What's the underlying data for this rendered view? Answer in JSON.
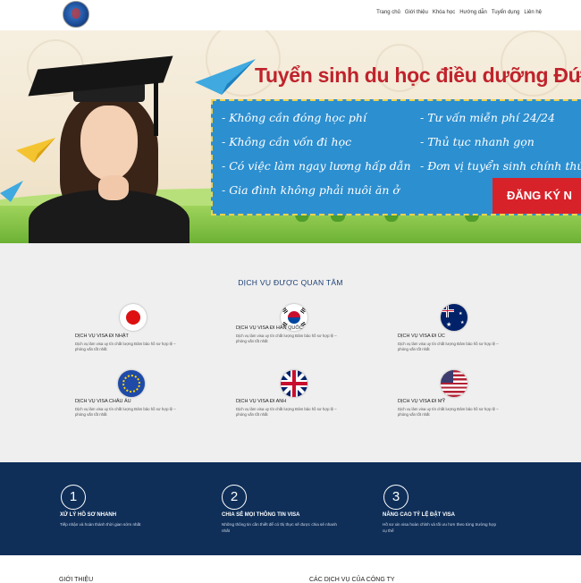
{
  "header": {
    "logo_alt": "logo",
    "nav": [
      "Trang chủ",
      "Giới thiệu",
      "Khóa học",
      "Hướng dẫn",
      "Tuyển dụng",
      "Liên hệ"
    ]
  },
  "hero": {
    "title": "Tuyển sinh du học điều dưỡng Đức",
    "left_items": [
      "- Không cần đóng học phí",
      "- Không cần vốn đi học",
      "- Có việc làm ngay lương hấp dẫn",
      "- Gia đình không phải nuôi ăn ở"
    ],
    "right_items": [
      "- Tư vấn miễn phí 24/24",
      "- Thủ tục nhanh gọn",
      "- Đơn vị tuyển sinh chính thức"
    ],
    "register_label": "ĐĂNG KÝ N"
  },
  "services": {
    "title": "DỊCH VỤ ĐƯỢC QUAN TÂM",
    "items": [
      {
        "flag": "japan-flag",
        "title": "DỊCH VỤ VISA ĐI NHẬT",
        "desc": "Dịch vụ làm visa uy tín chất lượng Đảm bảo hồ sơ hợp lệ – phỏng vấn tốt nhất"
      },
      {
        "flag": "korea-flag",
        "title": "DỊCH VỤ VISA ĐI HÀN QUỐC",
        "desc": "Dịch vụ làm visa uy tín chất lượng Đảm bảo hồ sơ hợp lệ – phỏng vấn tốt nhất"
      },
      {
        "flag": "australia-flag",
        "title": "DỊCH VỤ VISA ĐI ÚC",
        "desc": "Dịch vụ làm visa uy tín chất lượng Đảm bảo hồ sơ hợp lệ – phỏng vấn tốt nhất"
      },
      {
        "flag": "eu-flag",
        "title": "DỊCH VỤ VISA CHÂU ÂU",
        "desc": "Dịch vụ làm visa uy tín chất lượng Đảm bảo hồ sơ hợp lệ – phỏng vấn tốt nhất"
      },
      {
        "flag": "uk-flag",
        "title": "DỊCH VỤ VISA ĐI ANH",
        "desc": "Dịch vụ làm visa uy tín chất lượng Đảm bảo hồ sơ hợp lệ – phỏng vấn tốt nhất"
      },
      {
        "flag": "usa-flag",
        "title": "DỊCH VỤ VISA ĐI MỸ",
        "desc": "Dịch vụ làm visa uy tín chất lượng Đảm bảo hồ sơ hợp lệ – phỏng vấn tốt nhất"
      }
    ]
  },
  "steps": [
    {
      "number": "1",
      "title": "XỬ LÝ HỒ SƠ NHANH",
      "desc": "Tiếp nhận và hoàn thành thời gian sớm nhất"
    },
    {
      "number": "2",
      "title": "CHIA SẺ MỌI THÔNG TIN VISA",
      "desc": "Những thông tin cần thiết để có thị thực sẽ được chia sẻ nhanh nhất"
    },
    {
      "number": "3",
      "title": "NÂNG CAO TỶ LỆ ĐẬT VISA",
      "desc": "Hồ sơ xin visa hoàn chỉnh và tối ưu hơn theo từng trường hợp cụ thể"
    }
  ],
  "footer": {
    "left_title": "GIỚI THIỆU",
    "right_title": "CÁC DỊCH VỤ CỦA CÔNG TY"
  },
  "colors": {
    "accent_red": "#c0232c",
    "navy": "#0f2f59",
    "board_blue": "#2c8fd0"
  }
}
